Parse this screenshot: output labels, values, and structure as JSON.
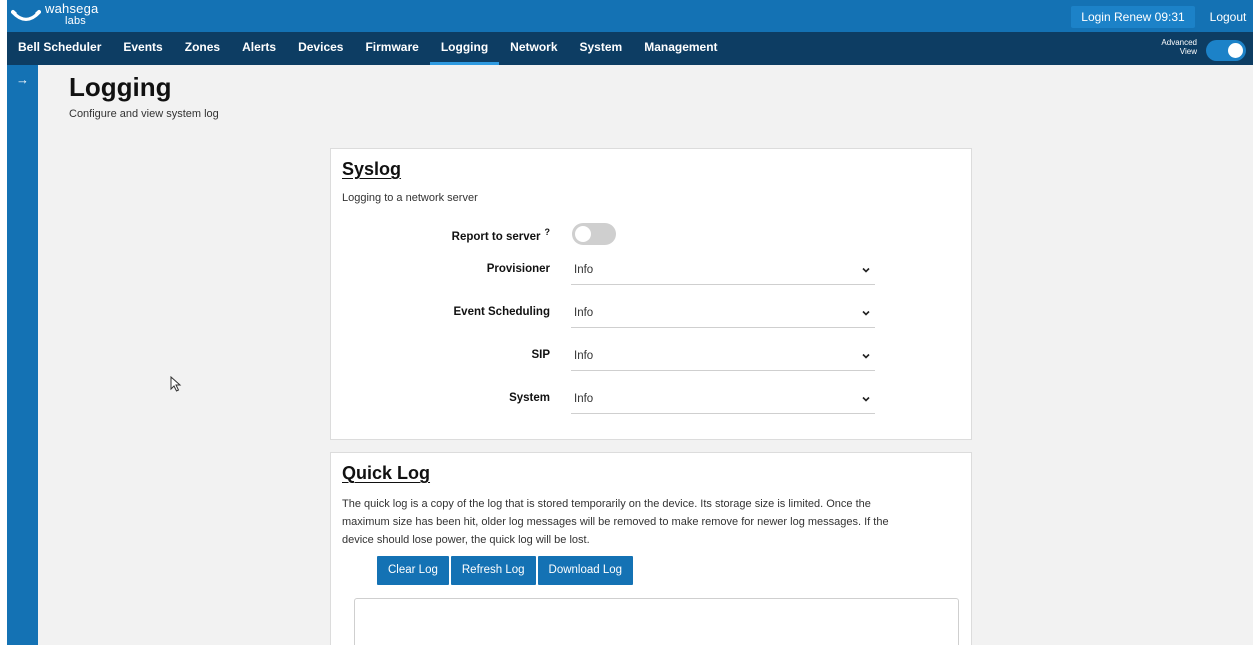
{
  "header": {
    "logo_line1": "wahsega",
    "logo_line2": "labs",
    "login_renew": "Login Renew 09:31",
    "logout": "Logout"
  },
  "nav": {
    "items": [
      {
        "label": "Bell Scheduler"
      },
      {
        "label": "Events"
      },
      {
        "label": "Zones"
      },
      {
        "label": "Alerts"
      },
      {
        "label": "Devices"
      },
      {
        "label": "Firmware"
      },
      {
        "label": "Logging",
        "active": true
      },
      {
        "label": "Network"
      },
      {
        "label": "System"
      },
      {
        "label": "Management"
      }
    ],
    "advanced_view_label_1": "Advanced",
    "advanced_view_label_2": "View",
    "advanced_view_on": true
  },
  "sidebar": {
    "toggle_icon": "arrow-right-icon"
  },
  "page": {
    "title": "Logging",
    "subtitle": "Configure and view system log"
  },
  "syslog": {
    "title": "Syslog",
    "description": "Logging to a network server",
    "report_label": "Report to server",
    "report_help": "?",
    "report_enabled": false,
    "selects": [
      {
        "label": "Provisioner",
        "value": "Info"
      },
      {
        "label": "Event Scheduling",
        "value": "Info"
      },
      {
        "label": "SIP",
        "value": "Info"
      },
      {
        "label": "System",
        "value": "Info"
      }
    ]
  },
  "quicklog": {
    "title": "Quick Log",
    "desc_line1": "The quick log is a copy of the log that is stored temporarily on the device. Its storage size is limited. Once the",
    "desc_line2": "maximum size has been hit, older log messages will be removed to make remove for newer log messages. If the",
    "desc_line3": "device should lose power, the quick log will be lost.",
    "clear_label": "Clear Log",
    "refresh_label": "Refresh Log",
    "download_label": "Download Log"
  },
  "colors": {
    "header_blue": "#1472b4",
    "nav_dark": "#0d3d63",
    "page_bg": "#f2f2f2"
  }
}
